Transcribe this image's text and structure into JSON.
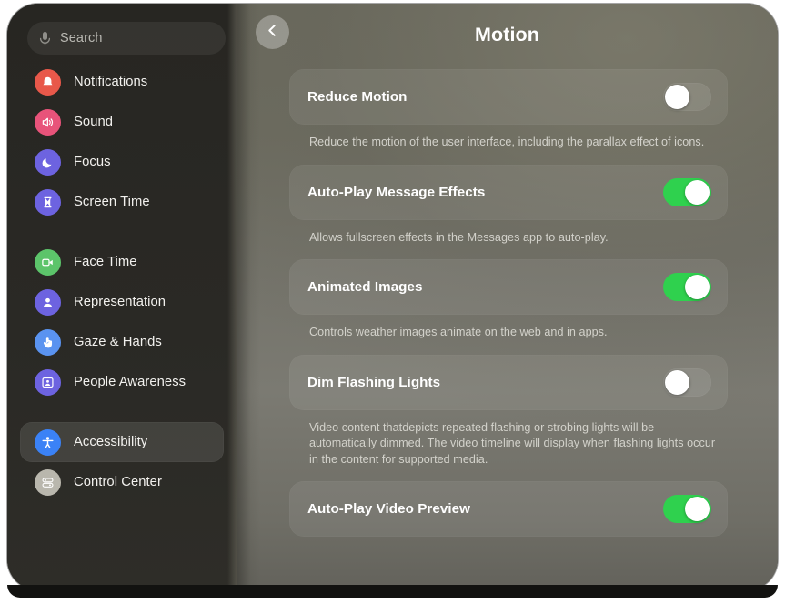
{
  "colors": {
    "toggle_on": "#2fd14e",
    "sidebar_bg": "#272622",
    "main_bg": "#6f6e66",
    "accent_blue": "#3b82f6"
  },
  "sidebar": {
    "search": {
      "placeholder": "Search",
      "value": "",
      "icon": "microphone-icon"
    },
    "groups": [
      {
        "items": [
          {
            "label": "Notifications",
            "icon": "bell-icon",
            "icon_bg": "#e8584a",
            "selected": false
          },
          {
            "label": "Sound",
            "icon": "speaker-icon",
            "icon_bg": "#e8537a",
            "selected": false
          },
          {
            "label": "Focus",
            "icon": "moon-icon",
            "icon_bg": "#6d63e0",
            "selected": false
          },
          {
            "label": "Screen Time",
            "icon": "hourglass-icon",
            "icon_bg": "#6d63e0",
            "selected": false
          }
        ]
      },
      {
        "items": [
          {
            "label": "Face Time",
            "icon": "video-camera-icon",
            "icon_bg": "#5cc46a",
            "selected": false
          },
          {
            "label": "Representation",
            "icon": "person-icon",
            "icon_bg": "#6d63e0",
            "selected": false
          },
          {
            "label": "Gaze & Hands",
            "icon": "hand-pointer-icon",
            "icon_bg": "#5a93f0",
            "selected": false
          },
          {
            "label": "People Awareness",
            "icon": "people-frame-icon",
            "icon_bg": "#6d63e0",
            "selected": false
          }
        ]
      },
      {
        "items": [
          {
            "label": "Accessibility",
            "icon": "accessibility-icon",
            "icon_bg": "#3b82f6",
            "selected": true
          },
          {
            "label": "Control Center",
            "icon": "sliders-icon",
            "icon_bg": "#b9b7ad",
            "selected": false
          }
        ]
      }
    ]
  },
  "main": {
    "back_button": "back-chevron-icon",
    "title": "Motion",
    "settings": [
      {
        "label": "Reduce Motion",
        "toggle": "off",
        "description": "Reduce the motion of the user interface, including the parallax effect of icons."
      },
      {
        "label": "Auto-Play Message Effects",
        "toggle": "on",
        "description": "Allows fullscreen effects in the Messages app to auto-play."
      },
      {
        "label": "Animated Images",
        "toggle": "on",
        "description": "Controls weather images animate on the web and in apps."
      },
      {
        "label": "Dim Flashing Lights",
        "toggle": "off",
        "description": "Video content thatdepicts repeated flashing or strobing lights will be automatically dimmed. The video timeline will display when flashing lights occur in the content for supported media."
      },
      {
        "label": "Auto-Play Video Preview",
        "toggle": "on",
        "description": ""
      }
    ]
  }
}
